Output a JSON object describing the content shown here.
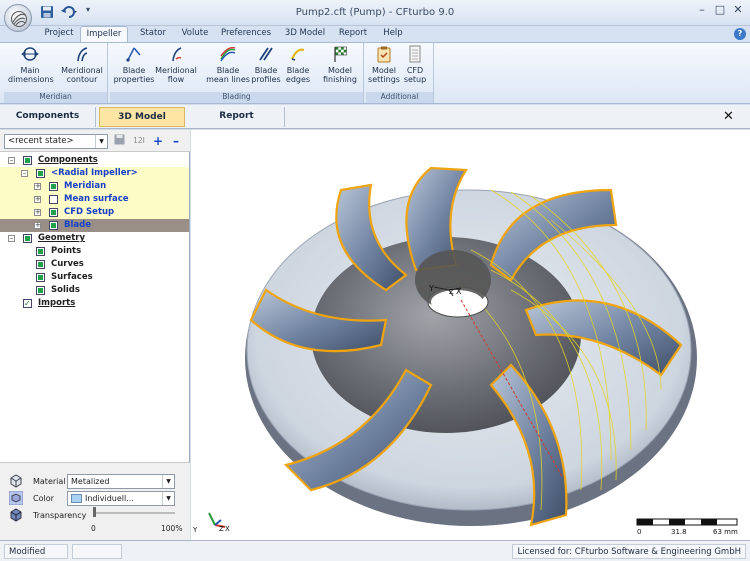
{
  "window": {
    "title": "Pump2.cft (Pump) - CFturbo 9.0",
    "controls": {
      "minimize": "–",
      "maximize": "□",
      "close": "✕"
    }
  },
  "quick_access": {
    "more": "▾"
  },
  "ribbon_tabs": [
    "Project",
    "Impeller",
    "Stator",
    "Volute",
    "Preferences",
    "3D Model",
    "Report",
    "Help"
  ],
  "ribbon_active_tab": "Impeller",
  "ribbon_groups": [
    {
      "label": "Meridian",
      "buttons": [
        {
          "label": "Main\ndimensions",
          "icon": "main-dimensions-icon"
        },
        {
          "label": "Meridional\ncontour",
          "icon": "meridional-contour-icon"
        }
      ]
    },
    {
      "label": "Blading",
      "buttons": [
        {
          "label": "Blade\nproperties",
          "icon": "blade-properties-icon"
        },
        {
          "label": "Meridional\nflow",
          "icon": "meridional-flow-icon"
        },
        {
          "label": "Blade\nmean lines",
          "icon": "blade-mean-lines-icon"
        },
        {
          "label": "Blade\nprofiles",
          "icon": "blade-profiles-icon"
        },
        {
          "label": "Blade\nedges",
          "icon": "blade-edges-icon"
        },
        {
          "label": "Model\nfinishing",
          "icon": "model-finishing-icon"
        }
      ]
    },
    {
      "label": "Additional",
      "buttons": [
        {
          "label": "Model\nsettings",
          "icon": "model-settings-icon"
        },
        {
          "label": "CFD\nsetup",
          "icon": "cfd-setup-icon"
        }
      ]
    }
  ],
  "panel_tabs": [
    "Components",
    "3D Model",
    "Report"
  ],
  "panel_active_tab": "3D Model",
  "panel_close": "✕",
  "state_select": {
    "value": "<recent state>"
  },
  "state_toolbar": {
    "save": "💾",
    "rename": "12I",
    "add": "+",
    "remove": "–"
  },
  "tree": [
    {
      "label": "Components",
      "level": 0,
      "expander": "⊟",
      "checked": "on",
      "style": "ul"
    },
    {
      "label": "<Radial Impeller>",
      "level": 1,
      "expander": "⊟",
      "checked": "on",
      "style": "blue",
      "highlight": "yel"
    },
    {
      "label": "Meridian",
      "level": 2,
      "expander": "⊞",
      "checked": "on",
      "style": "blue",
      "highlight": "yel"
    },
    {
      "label": "Mean surface",
      "level": 2,
      "expander": "⊞",
      "checked": "off",
      "style": "blue",
      "highlight": "yel"
    },
    {
      "label": "CFD Setup",
      "level": 2,
      "expander": "⊞",
      "checked": "on",
      "style": "blue",
      "highlight": "yel"
    },
    {
      "label": "Blade",
      "level": 2,
      "expander": "⊞",
      "checked": "on",
      "style": "blue",
      "highlight": "sel"
    },
    {
      "label": "Geometry",
      "level": 0,
      "expander": "⊟",
      "checked": "on",
      "style": "ul"
    },
    {
      "label": "Points",
      "level": 1,
      "expander": "",
      "checked": "on",
      "style": ""
    },
    {
      "label": "Curves",
      "level": 1,
      "expander": "",
      "checked": "on",
      "style": ""
    },
    {
      "label": "Surfaces",
      "level": 1,
      "expander": "",
      "checked": "on",
      "style": ""
    },
    {
      "label": "Solids",
      "level": 1,
      "expander": "",
      "checked": "on",
      "style": ""
    },
    {
      "label": "Imports",
      "level": 0,
      "expander": "",
      "checked": "tick",
      "style": "ul"
    }
  ],
  "appearance": {
    "material_label": "Material",
    "material_value": "Metalized",
    "color_label": "Color",
    "color_value": "Individuell...",
    "color_swatch": "#a9d3f0",
    "transparency_label": "Transparency",
    "transparency_min": "0",
    "transparency_max": "100%",
    "transparency_fraction": 0
  },
  "viewport": {
    "axis_center": {
      "y": "Y",
      "z": "Z",
      "x": "X"
    },
    "axis_corner": {
      "y": "Y",
      "z": "Z",
      "x": "X"
    },
    "scale": {
      "ticks": [
        "0",
        "31.8",
        "63 mm"
      ]
    },
    "colors": {
      "blade_edge": "#f0a410",
      "blade": "#6a7c93",
      "hub": "#5e6066",
      "shroud": "#c9d1dc"
    }
  },
  "status": {
    "left": "Modified",
    "right": "Licensed for: CFturbo Software & Engineering GmbH - orion"
  }
}
